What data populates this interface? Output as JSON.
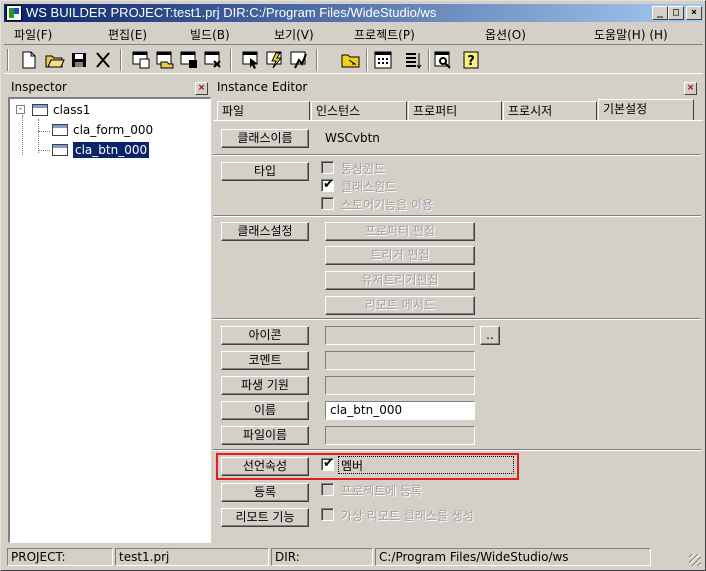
{
  "window": {
    "title": "WS BUILDER PROJECT:test1.prj DIR:C:/Program Files/WideStudio/ws",
    "controls": {
      "minimize": "_",
      "maximize": "□",
      "close": "×"
    }
  },
  "menu": [
    "파일(F)",
    "편집(E)",
    "빌드(B)",
    "보기(V)",
    "프로젝트(P)",
    "옵션(O)",
    "도움말(H) (H)"
  ],
  "toolbar_icons": [
    "new-file-icon",
    "open-folder-icon",
    "save-disk-icon",
    "cut-scissors-icon",
    "new-window-icon",
    "open-window-icon",
    "save-window-icon",
    "close-window-icon",
    "select-arrow-icon",
    "build-icon",
    "run-icon",
    "folder-open-icon",
    "grid-icon",
    "list-icon",
    "inspect-icon",
    "help-icon"
  ],
  "inspector": {
    "title": "Inspector",
    "tree": [
      {
        "label": "class1",
        "expander": "-"
      },
      {
        "label": "cla_form_000"
      },
      {
        "label": "cla_btn_000",
        "selected": true
      }
    ]
  },
  "editor": {
    "title": "Instance Editor",
    "tabs": [
      "파일",
      "인스턴스",
      "프로퍼티",
      "프로시저",
      "기본설정"
    ],
    "class_name_label": "클래스이름",
    "class_name_value": "WSCvbtn",
    "type_label": "타입",
    "type_options": [
      {
        "label": "통상윈드",
        "checked": false
      },
      {
        "label": "클래스윈드",
        "checked": true
      },
      {
        "label": "스토어기능을 이용",
        "checked": false
      }
    ],
    "class_settings_label": "클래스설정",
    "class_settings_buttons": [
      "프로퍼티 편집",
      "트리거 편집",
      "유저트리거편집",
      "리모트 메서드"
    ],
    "icon_label": "아이콘",
    "icon_browse": "..",
    "comment_label": "코멘트",
    "derived_label": "파생 기원",
    "name_label": "이름",
    "name_value": "cla_btn_000",
    "filename_label": "파일이름",
    "declare_label": "선언속성",
    "declare_option": {
      "label": "멤버",
      "checked": true
    },
    "register_label": "등록",
    "register_option": "프로젝트에 등록",
    "remote_label": "리모트 기능",
    "remote_option": "가상 리모트 클래스를 생성",
    "highlight_color": "#e02020"
  },
  "status": {
    "project_label": "PROJECT:",
    "project_value": "test1.prj",
    "dir_label": "DIR:",
    "dir_value": "C:/Program Files/WideStudio/ws"
  }
}
